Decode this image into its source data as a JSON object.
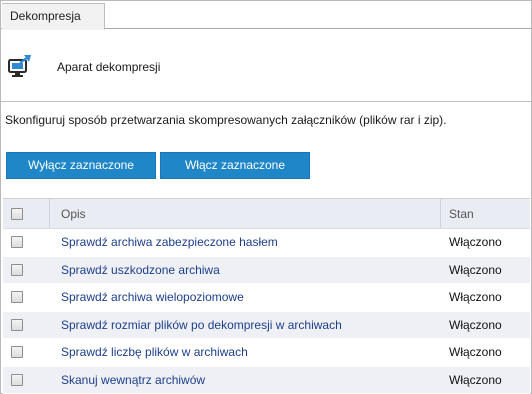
{
  "tab": {
    "label": "Dekompresja"
  },
  "header": {
    "title": "Aparat dekompresji",
    "icon": "monitor-arrow-icon"
  },
  "description": "Skonfiguruj sposób przetwarzania skompresowanych załączników (plików rar i zip).",
  "buttons": {
    "disable_label": "Wyłącz zaznaczone",
    "enable_label": "Włącz zaznaczone"
  },
  "table": {
    "columns": [
      "Opis",
      "Stan"
    ],
    "rows": [
      {
        "label": "Sprawdź archiwa zabezpieczone hasłem",
        "state": "Włączono",
        "checked": false
      },
      {
        "label": "Sprawdź uszkodzone archiwa",
        "state": "Włączono",
        "checked": false
      },
      {
        "label": "Sprawdź archiwa wielopoziomowe",
        "state": "Włączono",
        "checked": false
      },
      {
        "label": "Sprawdź rozmiar plików po dekompresji w archiwach",
        "state": "Włączono",
        "checked": false
      },
      {
        "label": "Sprawdź liczbę plików w archiwach",
        "state": "Włączono",
        "checked": false
      },
      {
        "label": "Skanuj wewnątrz archiwów",
        "state": "Włączono",
        "checked": false
      }
    ]
  },
  "colors": {
    "accent": "#1f86c7",
    "link": "#1d3f8a",
    "row_alt": "#eef0f5",
    "header_bg": "#e9ecf2"
  }
}
